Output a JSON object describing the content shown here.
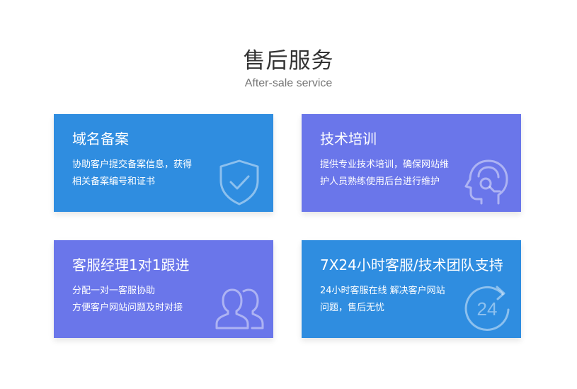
{
  "section": {
    "title": "售后服务",
    "subtitle": "After-sale service"
  },
  "cards": [
    {
      "title": "域名备案",
      "desc_lines": [
        "协助客户提交备案信息，获得",
        "相关备案编号和证书"
      ],
      "icon": "shield-check-icon",
      "color": "#2f8de0"
    },
    {
      "title": "技术培训",
      "desc_lines": [
        "提供专业技术培训，确保网站维",
        "护人员熟练使用后台进行维护"
      ],
      "icon": "headset-support-icon",
      "color": "#6a76ea"
    },
    {
      "title": "客服经理1对1跟进",
      "desc_lines": [
        "分配一对一客服协助",
        "方便客户网站问题及时对接"
      ],
      "icon": "users-icon",
      "color": "#6a76ea"
    },
    {
      "title": "7X24小时客服/技术团队支持",
      "desc_lines": [
        "24小时客服在线 解决客户网站",
        "问题，售后无忧"
      ],
      "icon": "24-hour-icon",
      "icon_text": "24",
      "color": "#2f8de0"
    }
  ]
}
